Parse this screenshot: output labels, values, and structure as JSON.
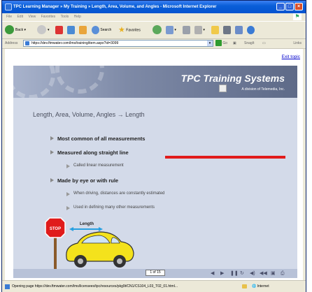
{
  "window": {
    "title": "TPC Learning Manager » My Training » Length, Area, Volume, and Angles - Microsoft Internet Explorer"
  },
  "menu": [
    "File",
    "Edit",
    "View",
    "Favorites",
    "Tools",
    "Help"
  ],
  "toolbar": {
    "back": "Back",
    "search": "Search",
    "favorites": "Favorites",
    "snagit": "SnagIt"
  },
  "addressbar": {
    "label": "Address",
    "url": "https://dev.ftmwater.com/lms/training/item.aspx?id=3099",
    "go": "Go",
    "links": "Links"
  },
  "page": {
    "exit_link": "Exit topic"
  },
  "slide": {
    "brand": "TPC Training Systems",
    "brand_sub": "A division of Telemedia, Inc.",
    "heading": "Length, Area, Volume, Angles → Length",
    "bullets": [
      {
        "text": "Most common of all measurements",
        "level": 1
      },
      {
        "text": "Measured along straight line",
        "level": 1
      },
      {
        "text": "Called linear measurement",
        "level": 2
      },
      {
        "text": "Made by eye or with rule",
        "level": 1
      },
      {
        "text": "When driving, distances are constantly estimated",
        "level": 2
      },
      {
        "text": "Used in defining many other measurements",
        "level": 2
      }
    ],
    "illustration": {
      "sign_text": "STOP",
      "dimension_label": "Length"
    },
    "page_indicator": "1 of 15",
    "accent_line_color": "#e11b1b"
  },
  "statusbar": {
    "text": "Opening page https://dev.ftmwater.com/lms/licensees/tpc/resources/pkg9t/CN1/CS104_L03_T02_01.html...",
    "zone": "Internet"
  }
}
